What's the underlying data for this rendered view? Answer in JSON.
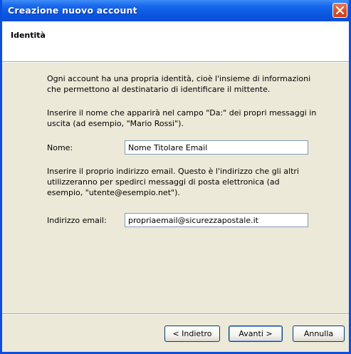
{
  "window": {
    "title": "Creazione nuovo account"
  },
  "header": {
    "title": "Identità"
  },
  "main": {
    "intro": "Ogni account ha una propria identità, cioè l'insieme di informazioni che permettono al destinatario di identificare il mittente.",
    "name_instructions": "Inserire il nome che apparirà nel campo \"Da:\" dei propri messaggi in uscita (ad esempio, \"Mario Rossi\").",
    "name_label": "Nome:",
    "name_value": "Nome Titolare Email",
    "email_instructions": "Inserire il proprio indirizzo email. Questo è l'indirizzo che gli altri utilizzeranno per spedirci messaggi di posta elettronica (ad esempio, \"utente@esempio.net\").",
    "email_label": "Indirizzo email:",
    "email_value": "propriaemail@sicurezzapostale.it"
  },
  "footer": {
    "back_label": "< Indietro",
    "next_label": "Avanti >",
    "cancel_label": "Annulla"
  },
  "icons": {
    "close": "close-icon"
  },
  "colors": {
    "titlebar": "#0b55e0",
    "close_button": "#d7542f",
    "dialog_bg": "#ece9d8",
    "header_bg": "#ffffff"
  }
}
